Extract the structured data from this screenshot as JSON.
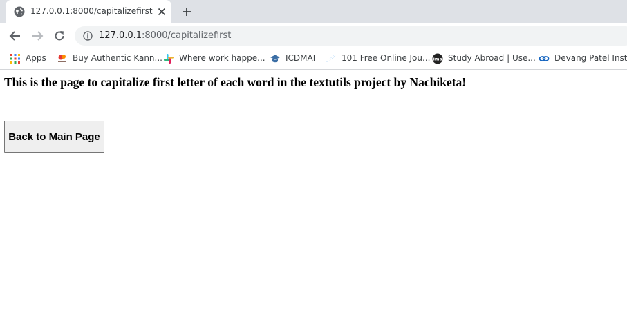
{
  "browser": {
    "tab": {
      "title": "127.0.0.1:8000/capitalizefirst",
      "favicon": "globe-icon"
    },
    "address_bar": {
      "host": "127.0.0.1",
      "path": ":8000/capitalizefirst"
    },
    "bookmarks": [
      {
        "label": "Apps",
        "icon": "apps-grid-icon"
      },
      {
        "label": "Buy Authentic Kann...",
        "icon": "brand-logo-icon"
      },
      {
        "label": "Where work happe...",
        "icon": "slack-icon"
      },
      {
        "label": "ICDMAI",
        "icon": "graduation-cap-icon"
      },
      {
        "label": "101 Free Online Jou...",
        "icon": "swoosh-logo-icon"
      },
      {
        "label": "Study Abroad | Use...",
        "icon": "ims-logo-icon"
      },
      {
        "label": "Devang Patel Instit...",
        "icon": "chain-link-icon"
      }
    ]
  },
  "page": {
    "heading": "This is the page to capitalize first letter of each word in the textutils project by Nachiketa!",
    "back_button": "Back to Main Page"
  },
  "colors": {
    "tab_strip": "#dee1e6",
    "omnibox": "#f1f3f4",
    "text_dark": "#202124",
    "icon_gray": "#5f6368",
    "button_bg": "#efefef",
    "button_border": "#767676"
  }
}
